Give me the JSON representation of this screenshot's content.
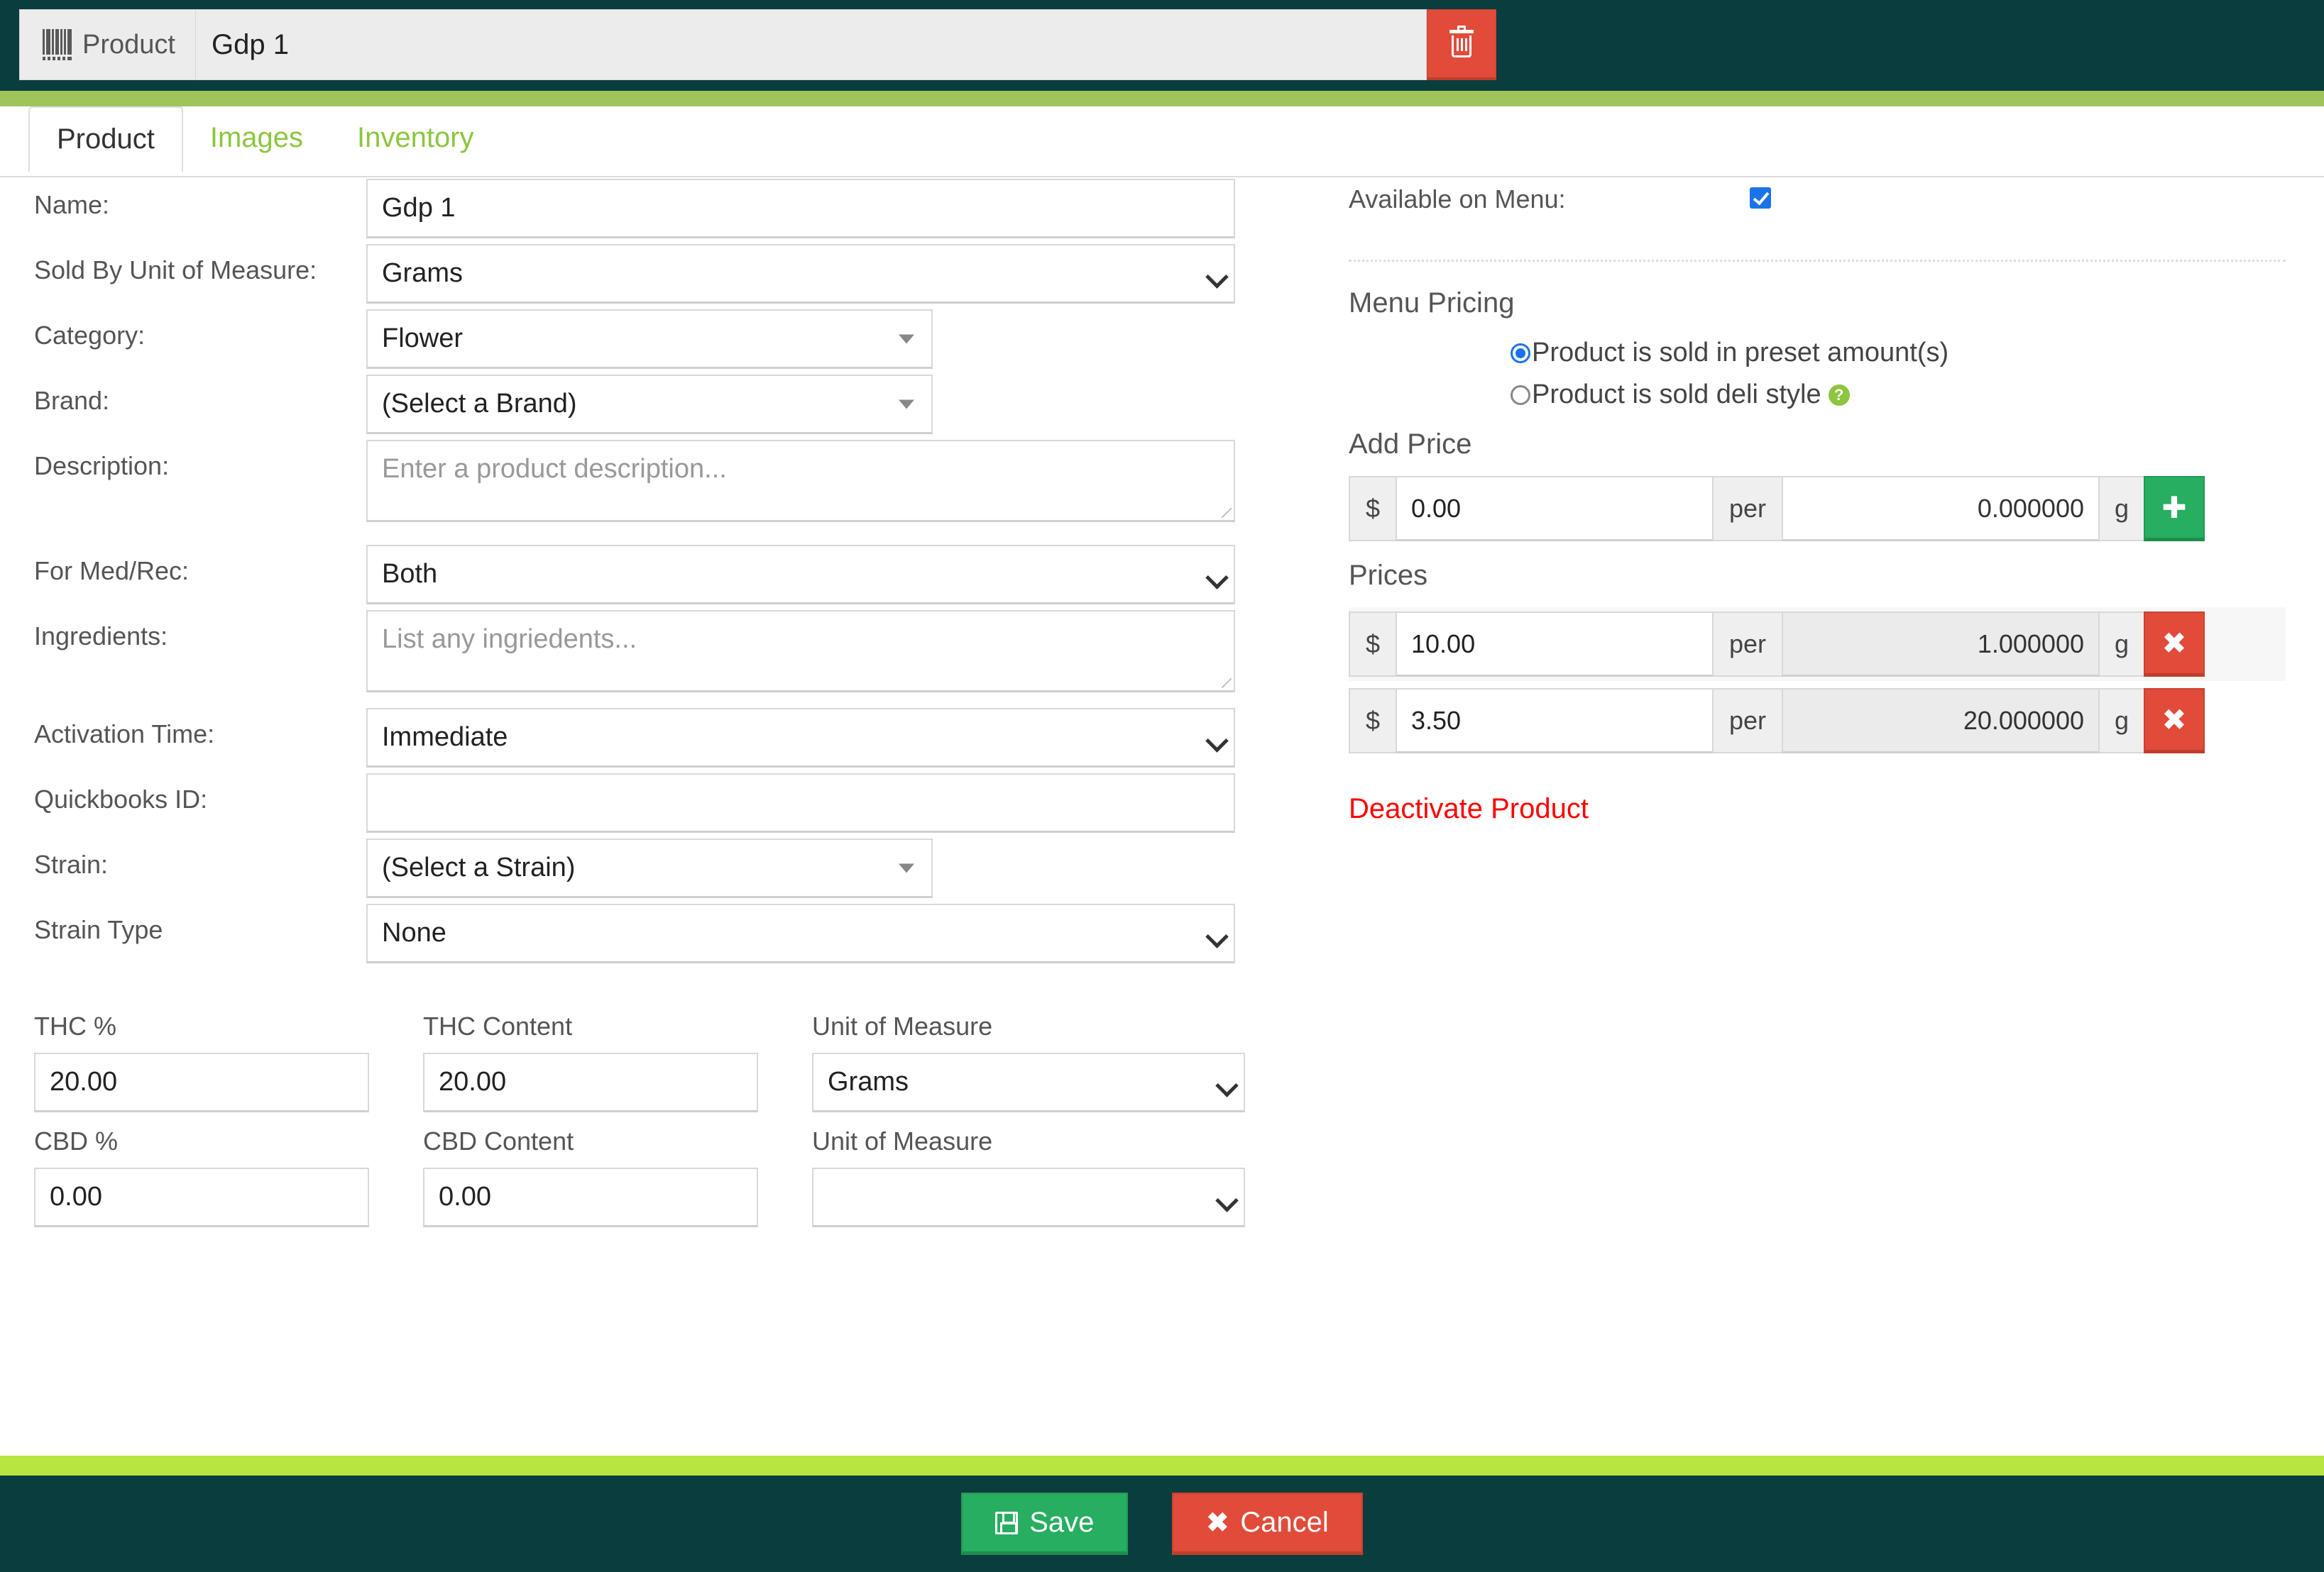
{
  "header": {
    "product_tag_label": "Product",
    "product_name_value": "Gdp 1",
    "delete_icon": "trash-icon"
  },
  "tabs": [
    {
      "label": "Product",
      "active": true
    },
    {
      "label": "Images",
      "active": false
    },
    {
      "label": "Inventory",
      "active": false
    }
  ],
  "form": {
    "name": {
      "label": "Name:",
      "value": "Gdp 1"
    },
    "sold_by_uom": {
      "label": "Sold By Unit of Measure:",
      "value": "Grams"
    },
    "category": {
      "label": "Category:",
      "value": "Flower"
    },
    "brand": {
      "label": "Brand:",
      "value": "(Select a Brand)"
    },
    "description": {
      "label": "Description:",
      "value": "",
      "placeholder": "Enter a product description..."
    },
    "med_rec": {
      "label": "For Med/Rec:",
      "value": "Both"
    },
    "ingredients": {
      "label": "Ingredients:",
      "value": "",
      "placeholder": "List any ingriedents..."
    },
    "activation_time": {
      "label": "Activation Time:",
      "value": "Immediate"
    },
    "quickbooks_id": {
      "label": "Quickbooks ID:",
      "value": ""
    },
    "strain": {
      "label": "Strain:",
      "value": "(Select a Strain)"
    },
    "strain_type": {
      "label": "Strain Type",
      "value": "None"
    }
  },
  "chemistry": {
    "thc_pct_label": "THC %",
    "thc_content_label": "THC Content",
    "thc_uom_label": "Unit of Measure",
    "thc_pct_value": "20.00",
    "thc_content_value": "20.00",
    "thc_uom_value": "Grams",
    "cbd_pct_label": "CBD %",
    "cbd_content_label": "CBD Content",
    "cbd_uom_label": "Unit of Measure",
    "cbd_pct_value": "0.00",
    "cbd_content_value": "0.00",
    "cbd_uom_value": ""
  },
  "menu": {
    "available_label": "Available on Menu:",
    "available_checked": true,
    "pricing_title": "Menu Pricing",
    "radio_preset_label": "Product is sold in preset amount(s)",
    "radio_deli_label": "Product is sold deli style",
    "deli_help_icon": "question-mark-icon",
    "selected_mode": "preset"
  },
  "add_price": {
    "title": "Add Price",
    "currency_symbol": "$",
    "price_value": "0.00",
    "per_label": "per",
    "qty_value": "0.000000",
    "unit_label": "g",
    "add_icon": "plus-icon"
  },
  "prices": {
    "title": "Prices",
    "currency_symbol": "$",
    "per_label": "per",
    "unit_label": "g",
    "remove_icon": "x-icon",
    "rows": [
      {
        "price": "10.00",
        "qty": "1.000000"
      },
      {
        "price": "3.50",
        "qty": "20.000000"
      }
    ]
  },
  "actions": {
    "deactivate_label": "Deactivate Product",
    "save_label": "Save",
    "save_icon": "floppy-disk-icon",
    "cancel_label": "Cancel",
    "cancel_icon": "x-icon"
  },
  "colors": {
    "header_bg": "#0a3d3d",
    "stripe_top": "#9ec45a",
    "stripe_bottom": "#b8e53f",
    "accent_green": "#8cc63e",
    "danger_red": "#e04b3a",
    "success_green": "#27ae60",
    "link_red": "#ff0000",
    "checkbox_blue": "#1a73e8"
  }
}
